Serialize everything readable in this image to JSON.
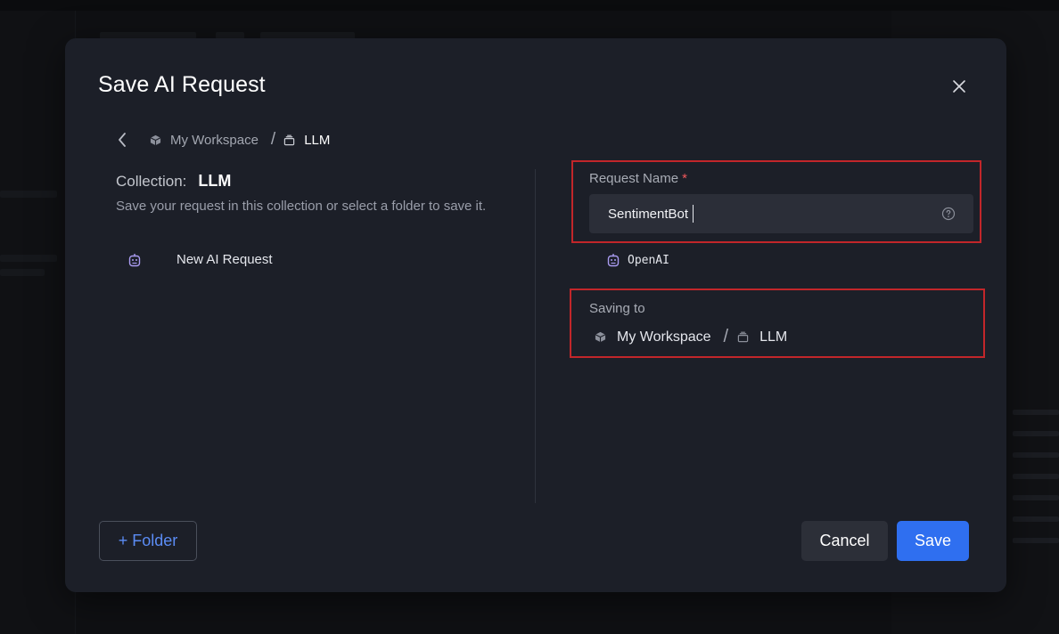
{
  "modal": {
    "title": "Save AI Request",
    "breadcrumb": {
      "workspace": "My Workspace",
      "separator": "/",
      "collection": "LLM"
    },
    "collection": {
      "label": "Collection:",
      "name": "LLM",
      "description": "Save your request in this collection or select a folder to save it."
    },
    "items": [
      {
        "label": "New AI Request",
        "icon": "robot-icon"
      }
    ],
    "request_name": {
      "label": "Request Name",
      "required_marker": "*",
      "value": "SentimentBot"
    },
    "provider": {
      "label": "OpenAI",
      "icon": "robot-icon"
    },
    "saving_to": {
      "label": "Saving to",
      "workspace": "My Workspace",
      "separator": "/",
      "collection": "LLM"
    },
    "buttons": {
      "folder": "+ Folder",
      "cancel": "Cancel",
      "save": "Save"
    }
  },
  "colors": {
    "modal_bg": "#1c1f28",
    "accent": "#2f6ff0",
    "link": "#5b8cf5",
    "highlight_border": "#c2262a",
    "robot": "#a99bf0",
    "required": "#f0585b"
  }
}
